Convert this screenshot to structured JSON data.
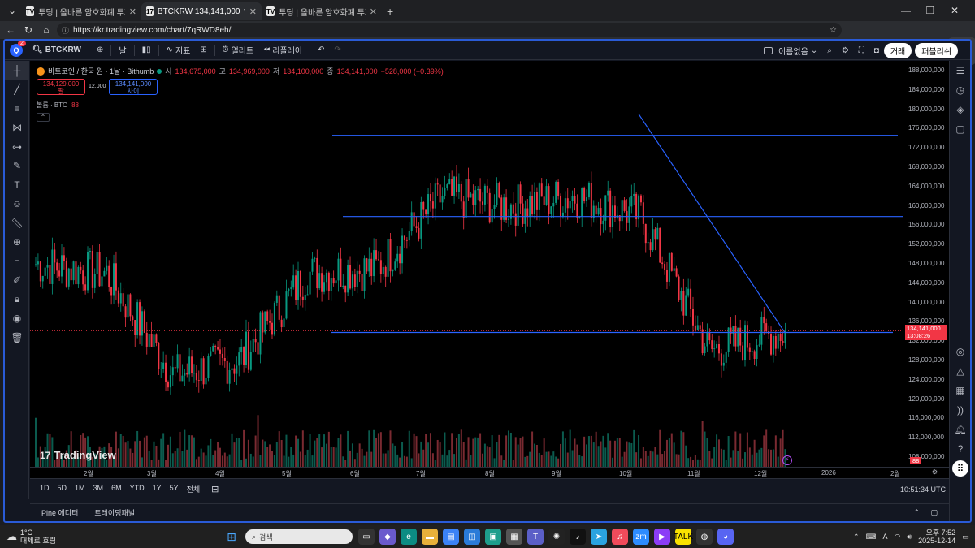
{
  "browser": {
    "tabs": [
      {
        "favicon": "TV",
        "title": "투딩 | 올바른 암호화폐 투자의 모",
        "active": false
      },
      {
        "favicon": "17",
        "title": "BTCKRW 134,141,000 ▼ −0.39%",
        "active": true
      },
      {
        "favicon": "TV",
        "title": "투딩 | 올바른 암호화폐 투자의 모",
        "active": false
      }
    ],
    "new_tab": "+",
    "url": "https://kr.tradingview.com/chart/7qRWD8eh/",
    "more": "···",
    "copilot": "채팅"
  },
  "topbar": {
    "badge": "2",
    "symbol": "BTCKRW",
    "interval": "날",
    "indicators": "지표",
    "alert": "얼러트",
    "replay": "리플레이",
    "layout_name": "이름없음",
    "trade": "거래",
    "publish": "퍼블리쉬"
  },
  "legend": {
    "title": "비트코인 / 한국 원 · 1날 · Bithumb",
    "o_label": "시",
    "o": "134,675,000",
    "h_label": "고",
    "h": "134,969,000",
    "l_label": "저",
    "l": "134,100,000",
    "c_label": "종",
    "c": "134,141,000",
    "change": "−528,000 (−0.39%)",
    "sell_price": "134,129,000",
    "sell_label": "팔",
    "spread": "12,000",
    "buy_price": "134,141,000",
    "buy_label": "사이",
    "volume_label": "볼륨 · BTC",
    "volume_value": "88"
  },
  "price_axis": {
    "ticks": [
      "188,000,000",
      "184,000,000",
      "180,000,000",
      "176,000,000",
      "172,000,000",
      "168,000,000",
      "164,000,000",
      "160,000,000",
      "156,000,000",
      "152,000,000",
      "148,000,000",
      "144,000,000",
      "140,000,000",
      "136,000,000",
      "132,000,000",
      "128,000,000",
      "124,000,000",
      "120,000,000",
      "116,000,000",
      "112,000,000",
      "108,000,000"
    ],
    "last_price": "134,141,000",
    "countdown": "13:08:26",
    "volume_tag": "88"
  },
  "time_axis": [
    "2월",
    "3월",
    "4월",
    "5월",
    "6월",
    "7월",
    "8월",
    "9월",
    "10월",
    "11월",
    "12월",
    "2026",
    "2월"
  ],
  "bottombar": {
    "ranges": [
      "1D",
      "5D",
      "1M",
      "3M",
      "6M",
      "YTD",
      "1Y",
      "5Y",
      "전체"
    ],
    "clock": "10:51:34 UTC"
  },
  "panels": {
    "pine": "Pine 에디터",
    "trading": "트레이딩패널"
  },
  "watermark": "TradingView",
  "chart_data": {
    "type": "candlestick",
    "symbol": "BTCKRW",
    "interval": "1D",
    "ylim": [
      106000000,
      190000000
    ],
    "x_labels": [
      "2월",
      "3월",
      "4월",
      "5월",
      "6월",
      "7월",
      "8월",
      "9월",
      "10월",
      "11월",
      "12월",
      "2026",
      "2월"
    ],
    "month_closes": [
      {
        "month": "1월",
        "close": 148000000
      },
      {
        "month": "2월",
        "close": 146000000
      },
      {
        "month": "3월",
        "close": 125000000
      },
      {
        "month": "4월",
        "close": 128000000
      },
      {
        "month": "5월",
        "close": 146000000
      },
      {
        "month": "6월",
        "close": 147000000
      },
      {
        "month": "7월",
        "close": 162000000
      },
      {
        "month": "8월",
        "close": 160000000
      },
      {
        "month": "9월",
        "close": 162000000
      },
      {
        "month": "10월",
        "close": 158000000
      },
      {
        "month": "11월",
        "close": 130000000
      },
      {
        "month": "12월",
        "close": 134141000
      }
    ],
    "horizontal_lines": [
      174600000,
      157800000,
      133800000
    ],
    "trendline": {
      "from": 179000000,
      "to": 133800000
    },
    "last_price": 134141000,
    "colors": {
      "up": "#089981",
      "down": "#f23645",
      "lines": "#2962ff"
    }
  }
}
